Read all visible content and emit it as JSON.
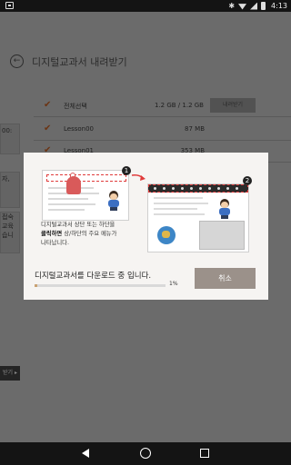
{
  "status_bar": {
    "time": "4:13"
  },
  "app": {
    "title": "디지털교과서 내려받기",
    "download_list": {
      "select_all_label": "전체선택",
      "total_size": "1.2 GB  /  1.2 GB",
      "download_button": "내려받기",
      "items": [
        {
          "name": "Lesson00",
          "size": "87 MB"
        },
        {
          "name": "Lesson01",
          "size": "353 MB"
        }
      ]
    },
    "side_fragments": [
      "00:",
      "자,",
      "접숙\n교육\n습니"
    ],
    "side_button": "받기 ▸"
  },
  "dialog": {
    "description_line1": "디지털교과서 상단 또는 하단을",
    "description_bold": "클릭하면",
    "description_line2": " 상/하단의 주요 메뉴가",
    "description_line3": "나타납니다.",
    "status_text": "디지털교과서를 다운로드 중 입니다.",
    "progress_fraction": 0.01,
    "progress_label": "1%",
    "cancel_label": "취소",
    "step_badges": [
      "1",
      "2"
    ]
  },
  "icons": {
    "back": "arrow-back-circle-icon",
    "check": "checkmark-icon",
    "nav_back": "nav-back-icon",
    "nav_home": "nav-home-icon",
    "nav_recents": "nav-recents-icon"
  },
  "colors": {
    "accent": "#c9a273",
    "cancel_button": "#9b918a",
    "highlight": "#e03a3a"
  }
}
